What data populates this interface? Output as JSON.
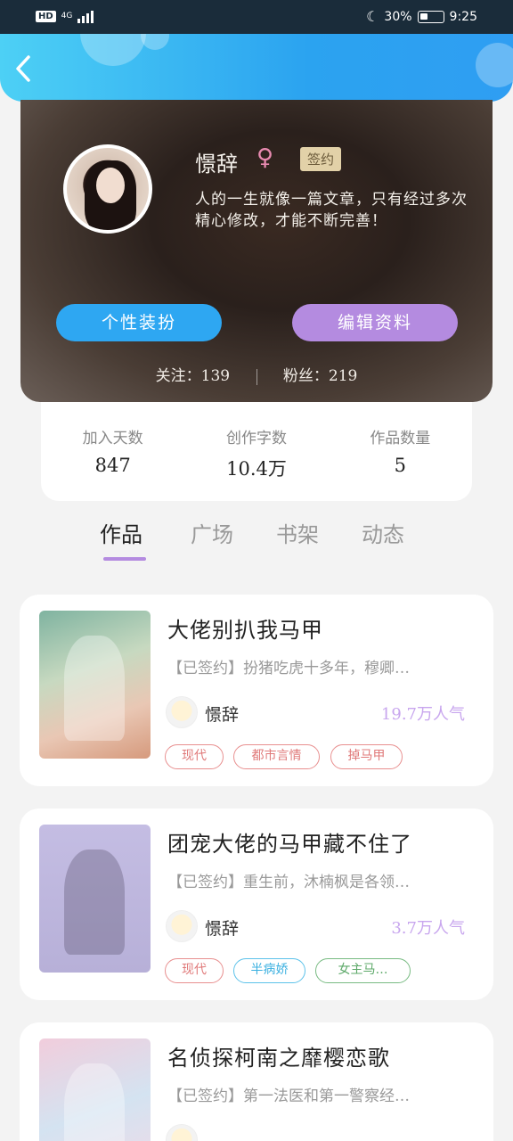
{
  "status_bar": {
    "hd": "HD",
    "network": "4G",
    "battery_percent": "30%",
    "time": "9:25"
  },
  "profile": {
    "username": "憬辞",
    "gender_symbol": "♀",
    "signed_badge": "签约",
    "bio": "人的一生就像一篇文章，只有经过多次精心修改，才能不断完善！",
    "customize_label": "个性装扮",
    "edit_label": "编辑资料",
    "follow_label": "关注：",
    "follow_count": "139",
    "fans_label": "粉丝：",
    "fans_count": "219"
  },
  "stats": [
    {
      "label": "加入天数",
      "value": "847"
    },
    {
      "label": "创作字数",
      "value": "10.4万"
    },
    {
      "label": "作品数量",
      "value": "5"
    }
  ],
  "tabs": [
    "作品",
    "广场",
    "书架",
    "动态"
  ],
  "works": [
    {
      "title": "大佬别扒我马甲",
      "desc": "【已签约】扮猪吃虎十多年，穆卿…",
      "author": "憬辞",
      "popularity": "19.7万人气",
      "tags": [
        "现代",
        "都市言情",
        "掉马甲"
      ]
    },
    {
      "title": "团宠大佬的马甲藏不住了",
      "desc": "【已签约】重生前，沐楠枫是各领…",
      "author": "憬辞",
      "popularity": "3.7万人气",
      "tags": [
        "现代",
        "半病娇",
        "女主马…"
      ]
    },
    {
      "title": "名侦探柯南之靡樱恋歌",
      "desc": "【已签约】第一法医和第一警察经…"
    }
  ],
  "colors": {
    "accent_blue": "#2ea7f2",
    "accent_purple": "#b48be0",
    "popularity": "#c8a6ee"
  }
}
